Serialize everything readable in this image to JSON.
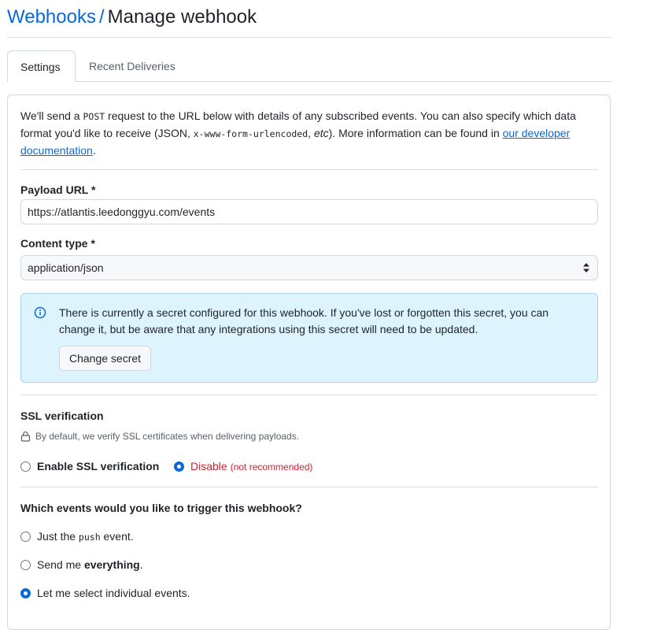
{
  "header": {
    "crumb": "Webhooks",
    "separator": "/",
    "title": "Manage webhook"
  },
  "tabs": [
    {
      "label": "Settings"
    },
    {
      "label": "Recent Deliveries"
    }
  ],
  "intro": {
    "t1": "We'll send a ",
    "code1": "POST",
    "t2": " request to the URL below with details of any subscribed events. You can also specify which data format you'd like to receive (JSON, ",
    "code2": "x-www-form-urlencoded",
    "t3": ", ",
    "etc": "etc",
    "t4": "). More information can be found in ",
    "link": "our developer documentation",
    "t5": "."
  },
  "payload": {
    "label": "Payload URL *",
    "value": "https://atlantis.leedonggyu.com/events"
  },
  "content_type": {
    "label": "Content type *",
    "value": "application/json"
  },
  "secret_notice": {
    "text": "There is currently a secret configured for this webhook. If you've lost or forgotten this secret, you can change it, but be aware that any integrations using this secret will need to be updated.",
    "button": "Change secret"
  },
  "ssl": {
    "title": "SSL verification",
    "note": "By default, we verify SSL certificates when delivering payloads.",
    "enable": "Enable SSL verification",
    "disable": "Disable",
    "not_recommended": "(not recommended)"
  },
  "events": {
    "question": "Which events would you like to trigger this webhook?",
    "opt1_pre": "Just the ",
    "opt1_code": "push",
    "opt1_post": " event.",
    "opt2_pre": "Send me ",
    "opt2_bold": "everything",
    "opt2_post": ".",
    "opt3": "Let me select individual events."
  },
  "colors": {
    "link": "#0969da",
    "danger": "#cf222e",
    "flash_bg": "#ddf4ff"
  }
}
